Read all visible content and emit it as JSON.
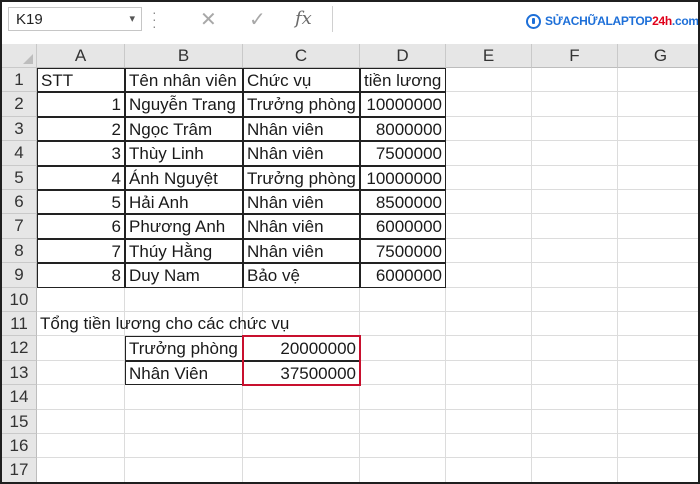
{
  "formula_bar": {
    "name_box": "K19",
    "name_box_arrow": "▾",
    "cancel_icon": "✕",
    "enter_icon": "✓",
    "fx_icon": "fx",
    "formula": ""
  },
  "logo": {
    "text_blue": "SỬACHỮALAPTOP",
    "text_red": "24h",
    "text_tail": ".com"
  },
  "columns": [
    "A",
    "B",
    "C",
    "D",
    "E",
    "F",
    "G"
  ],
  "rows": [
    "1",
    "2",
    "3",
    "4",
    "5",
    "6",
    "7",
    "8",
    "9",
    "10",
    "11",
    "12",
    "13",
    "14",
    "15",
    "16",
    "17"
  ],
  "table": {
    "headers": [
      "STT",
      "Tên nhân viên",
      "Chức vụ",
      "tiền lương"
    ],
    "rows": [
      [
        "1",
        "Nguyễn Trang",
        "Trưởng phòng",
        "10000000"
      ],
      [
        "2",
        "Ngọc Trâm",
        "Nhân viên",
        "8000000"
      ],
      [
        "3",
        "Thùy Linh",
        "Nhân viên",
        "7500000"
      ],
      [
        "4",
        "Ánh Nguyệt",
        "Trưởng phòng",
        "10000000"
      ],
      [
        "5",
        "Hải Anh",
        "Nhân viên",
        "8500000"
      ],
      [
        "6",
        "Phương Anh",
        "Nhân viên",
        "6000000"
      ],
      [
        "7",
        "Thúy Hằng",
        "Nhân viên",
        "7500000"
      ],
      [
        "8",
        "Duy Nam",
        "Bảo vệ",
        "6000000"
      ]
    ]
  },
  "summary": {
    "title": "Tổng tiền lương cho các chức vụ",
    "rows": [
      [
        "Trưởng phòng",
        "20000000"
      ],
      [
        "Nhân Viên",
        "37500000"
      ]
    ]
  },
  "colors": {
    "highlight": "#c8102e",
    "header_bg": "#e6e6e6",
    "logo_blue": "#1d6fd8",
    "logo_red": "#e0001a"
  }
}
